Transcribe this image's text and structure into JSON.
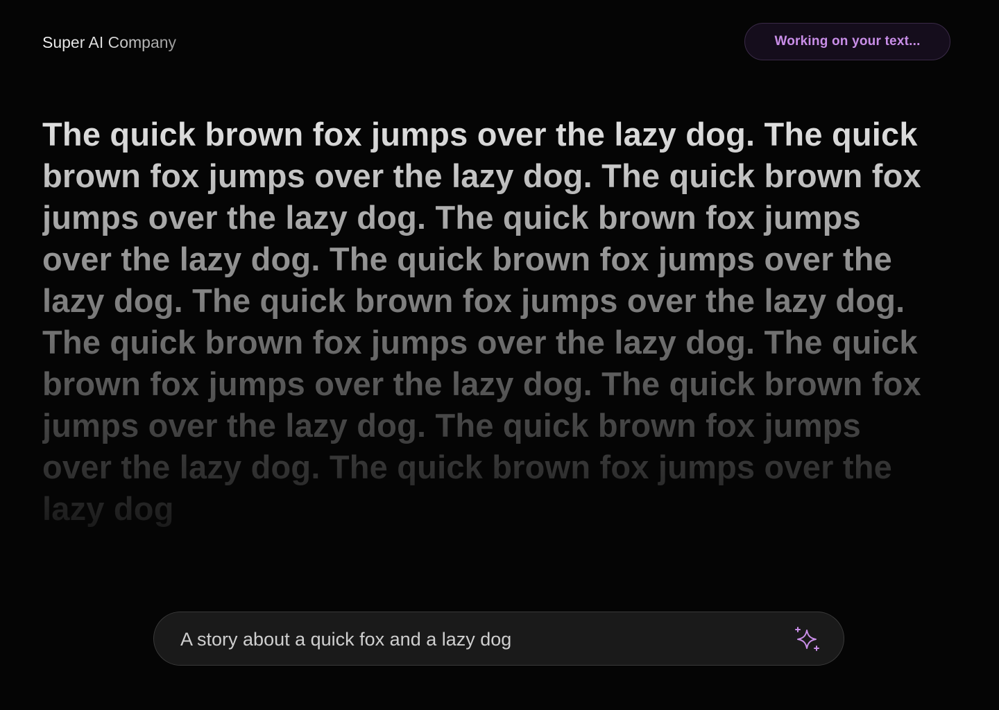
{
  "header": {
    "brand": "Super AI Company",
    "status": "Working on your text..."
  },
  "story": {
    "text": "The quick brown fox jumps over the lazy dog. The quick brown fox jumps over the lazy dog. The quick brown fox jumps over the lazy dog. The quick brown fox jumps over the lazy dog. The quick brown fox jumps over the lazy dog. The quick brown fox jumps over the lazy dog. The quick brown fox jumps over the lazy dog. The quick brown fox jumps over the lazy dog. The quick brown fox jumps over the lazy dog. The quick brown fox jumps over the lazy dog. The quick brown fox jumps over the lazy dog"
  },
  "prompt": {
    "text": "A story about a quick fox and a lazy dog",
    "icon": "sparkle-icon"
  },
  "colors": {
    "background": "#050505",
    "accent": "#c98ee8",
    "pill_background": "#150d1c",
    "input_background": "#1a1a1a"
  }
}
